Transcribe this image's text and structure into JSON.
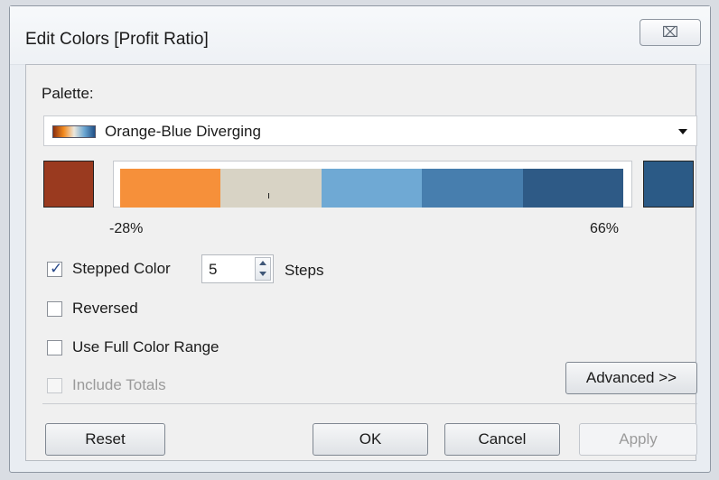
{
  "window": {
    "title": "Edit Colors [Profit Ratio]",
    "close_glyph": "⌧"
  },
  "palette": {
    "label": "Palette:",
    "selected": "Orange-Blue Diverging"
  },
  "color_ramp": {
    "start_color": "#9a3a1f",
    "end_color": "#2b5a86",
    "steps_colors": [
      "#f6903a",
      "#d8d3c5",
      "#6fa9d4",
      "#477eae",
      "#2e5a86"
    ],
    "min_label": "-28%",
    "max_label": "66%"
  },
  "options": {
    "stepped_color": {
      "label": "Stepped Color",
      "checked": true
    },
    "steps": {
      "value": "5",
      "label": "Steps"
    },
    "reversed": {
      "label": "Reversed",
      "checked": false
    },
    "use_full_range": {
      "label": "Use Full Color Range",
      "checked": false
    },
    "include_totals": {
      "label": "Include Totals",
      "checked": false,
      "disabled": true
    }
  },
  "buttons": {
    "advanced": "Advanced >>",
    "reset": "Reset",
    "ok": "OK",
    "cancel": "Cancel",
    "apply": "Apply"
  }
}
